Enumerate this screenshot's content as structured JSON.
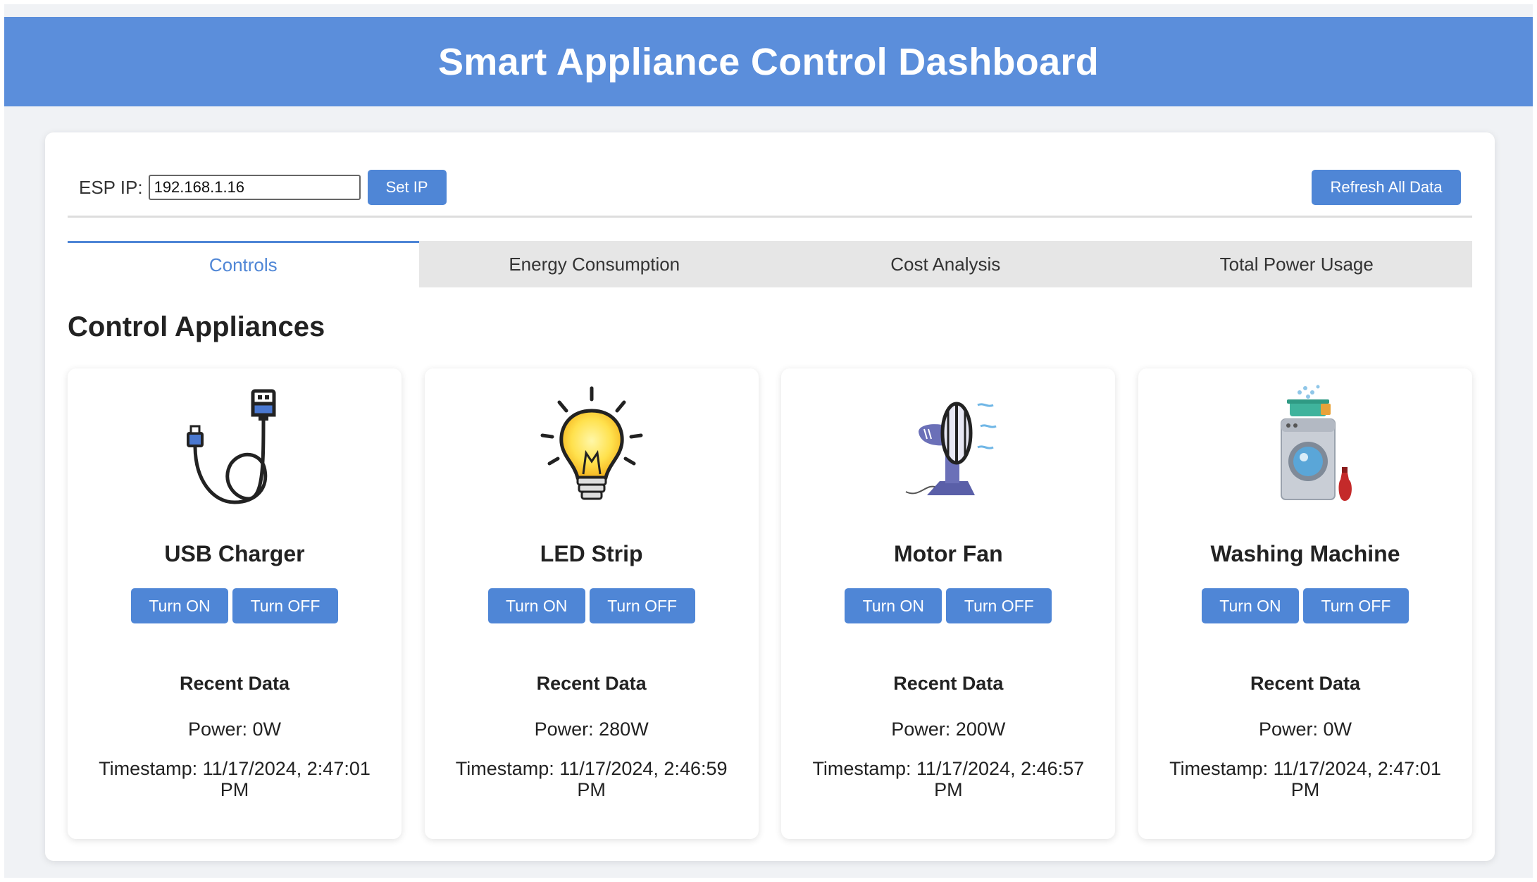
{
  "header": {
    "title": "Smart Appliance Control Dashboard"
  },
  "toolbar": {
    "ip_label": "ESP IP:",
    "ip_value": "192.168.1.16",
    "set_ip_label": "Set IP",
    "refresh_label": "Refresh All Data"
  },
  "tabs": [
    {
      "label": "Controls",
      "active": true
    },
    {
      "label": "Energy Consumption",
      "active": false
    },
    {
      "label": "Cost Analysis",
      "active": false
    },
    {
      "label": "Total Power Usage",
      "active": false
    }
  ],
  "section_title": "Control Appliances",
  "common": {
    "turn_on": "Turn ON",
    "turn_off": "Turn OFF",
    "recent_data": "Recent Data"
  },
  "appliances": [
    {
      "name": "USB Charger",
      "icon": "usb-cable-icon",
      "power": "Power: 0W",
      "timestamp": "Timestamp: 11/17/2024, 2:47:01 PM"
    },
    {
      "name": "LED Strip",
      "icon": "light-bulb-icon",
      "power": "Power: 280W",
      "timestamp": "Timestamp: 11/17/2024, 2:46:59 PM"
    },
    {
      "name": "Motor Fan",
      "icon": "desk-fan-icon",
      "power": "Power: 200W",
      "timestamp": "Timestamp: 11/17/2024, 2:46:57 PM"
    },
    {
      "name": "Washing Machine",
      "icon": "washing-machine-icon",
      "power": "Power: 0W",
      "timestamp": "Timestamp: 11/17/2024, 2:47:01 PM"
    }
  ],
  "colors": {
    "header_bg": "#5b8edb",
    "button_bg": "#4f86d6",
    "active_tab": "#4f86d6",
    "page_bg": "#f0f2f5"
  }
}
